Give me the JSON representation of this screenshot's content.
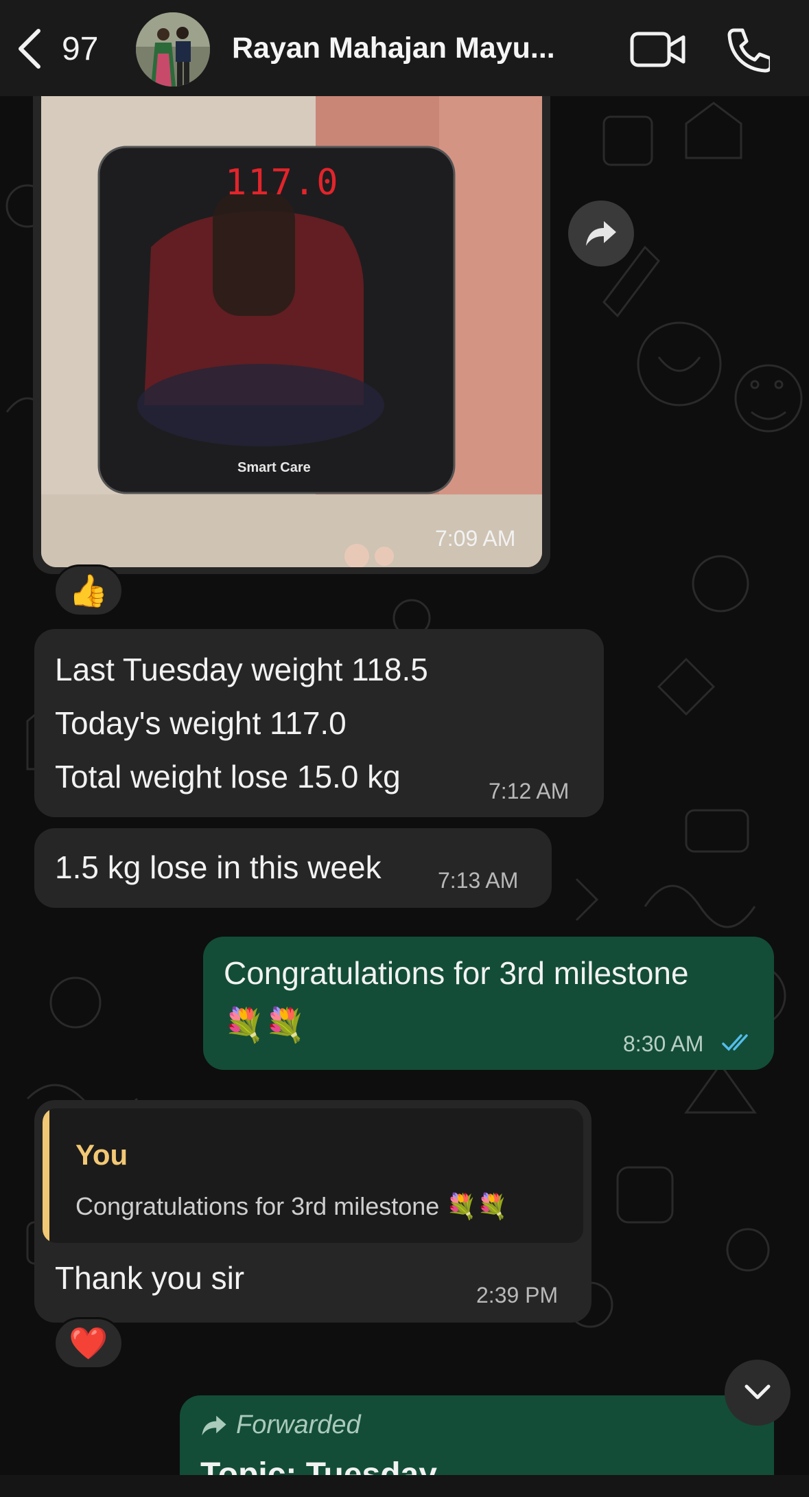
{
  "header": {
    "back_count": "97",
    "contact_name": "Rayan Mahajan Mayu..."
  },
  "messages": {
    "image_msg": {
      "scale_display": "117.0",
      "scale_brand": "Smart Care",
      "time": "7:09 AM",
      "reaction": "👍"
    },
    "weight_msg": {
      "line1": "Last Tuesday weight 118.5",
      "line2": "Today's weight 117.0",
      "line3": "Total weight lose 15.0 kg",
      "time": "7:12 AM"
    },
    "loss_msg": {
      "text": "1.5 kg lose in this week",
      "time": "7:13 AM"
    },
    "congrats_msg": {
      "text": "Congratulations for 3rd milestone",
      "emoji": "💐💐",
      "time": "8:30 AM"
    },
    "reply_msg": {
      "quote_author": "You",
      "quote_text": "Congratulations for 3rd milestone 💐💐",
      "text": "Thank you sir",
      "time": "2:39 PM",
      "reaction": "❤️"
    },
    "forwarded_msg": {
      "label": "Forwarded",
      "title": "Topic: Tuesday"
    }
  },
  "colors": {
    "incoming_bubble": "#262626",
    "outgoing_bubble": "#134d37",
    "quote_accent": "#f2c875",
    "read_ticks": "#53bdeb"
  },
  "icons": [
    "chevron-left-icon",
    "video-camera-icon",
    "phone-icon",
    "forward-arrow-icon",
    "double-check-icon",
    "chevron-down-icon"
  ]
}
